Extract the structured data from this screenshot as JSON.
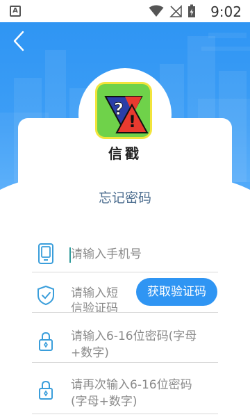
{
  "status_bar": {
    "app_badge": "A",
    "time": "9:02",
    "icons": [
      "wifi-icon",
      "signal-off-icon",
      "battery-charging-icon"
    ]
  },
  "header": {
    "back_icon": "chevron-left-icon"
  },
  "logo": {
    "symbol": "?!",
    "text": "信戳"
  },
  "page_title": "忘记密码",
  "form": {
    "phone": {
      "placeholder": "请输入手机号",
      "icon": "phone-icon"
    },
    "sms_code": {
      "placeholder_line1": "请输入短",
      "placeholder_line2": "信验证码",
      "icon": "shield-check-icon",
      "button_label": "获取验证码"
    },
    "password": {
      "placeholder_line1": "请输入6-16位密码(字母",
      "placeholder_line2": "+数字)",
      "icon": "lock-icon"
    },
    "confirm_password": {
      "placeholder_line1": "请再次输入6-16位密码",
      "placeholder_line2": "(字母+数字)",
      "icon": "lock-icon"
    }
  },
  "colors": {
    "primary": "#2f95f3",
    "icon": "#3a9edb",
    "title": "#4c6d8f",
    "placeholder": "#8a8a8a"
  }
}
